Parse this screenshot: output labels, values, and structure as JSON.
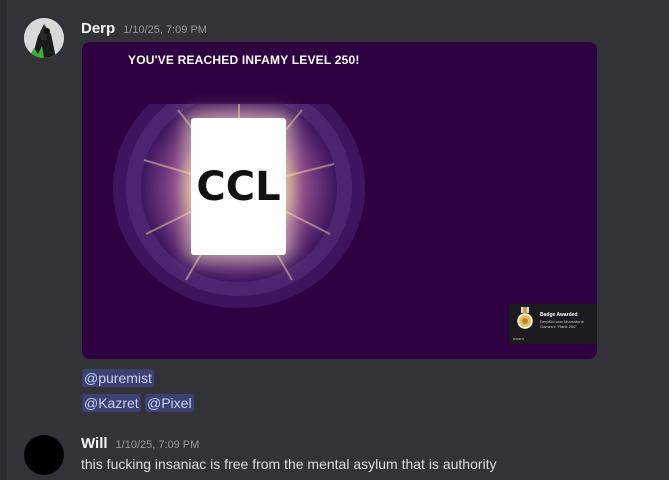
{
  "messages": [
    {
      "username": "Derp",
      "timestamp": "1/10/25, 7:09 PM",
      "embed": {
        "title": "YOU'VE REACHED INFAMY LEVEL 250!",
        "card_text": "CCL",
        "badge": {
          "title": "Badge Awarded",
          "description": "DerpKid won Moonstone Games's \"Rank 250\"",
          "footer": "award"
        }
      },
      "mentions": [
        [
          "@puremist"
        ],
        [
          "@Kazret",
          "@Pixel"
        ]
      ]
    },
    {
      "username": "Will",
      "timestamp": "1/10/25, 7:09 PM",
      "text": "this fucking insaniac is free from the mental asylum that is authority"
    }
  ],
  "colors": {
    "background": "#313338",
    "embed_background": "#2d0041",
    "mention_background": "#3c4270",
    "mention_text": "#c9cdfb"
  }
}
